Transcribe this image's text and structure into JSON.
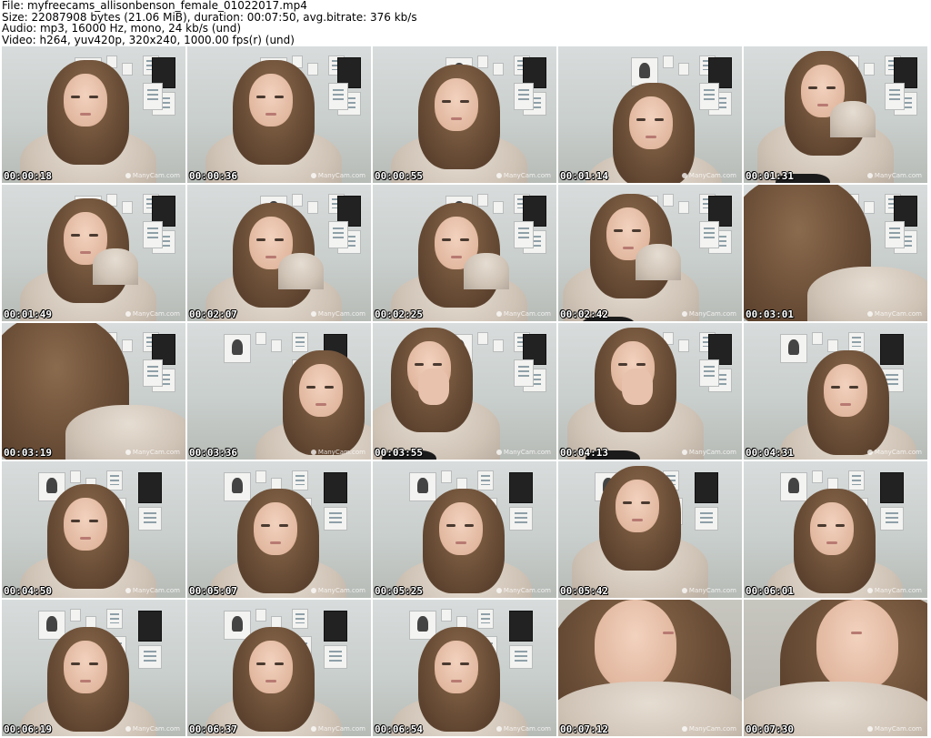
{
  "header": {
    "line1": "File: myfreecams_allisonbenson_female_01022017.mp4",
    "line2": "Size: 22087908 bytes (21.06 MiB), duration: 00:07:50, avg.bitrate: 376 kb/s",
    "line3": "Audio: mp3, 16000 Hz, mono, 24 kb/s (und)",
    "line4": "Video: h264, yuv420p, 320x240, 1000.00 fps(r) (und)"
  },
  "watermark": "ManyCam.com",
  "thumbnails": [
    {
      "time": "00:00:18"
    },
    {
      "time": "00:00:36"
    },
    {
      "time": "00:00:55"
    },
    {
      "time": "00:01:14"
    },
    {
      "time": "00:01:31"
    },
    {
      "time": "00:01:49"
    },
    {
      "time": "00:02:07"
    },
    {
      "time": "00:02:25"
    },
    {
      "time": "00:02:42"
    },
    {
      "time": "00:03:01"
    },
    {
      "time": "00:03:19"
    },
    {
      "time": "00:03:36"
    },
    {
      "time": "00:03:55"
    },
    {
      "time": "00:04:13"
    },
    {
      "time": "00:04:31"
    },
    {
      "time": "00:04:50"
    },
    {
      "time": "00:05:07"
    },
    {
      "time": "00:05:25"
    },
    {
      "time": "00:05:42"
    },
    {
      "time": "00:06:01"
    },
    {
      "time": "00:06:19"
    },
    {
      "time": "00:06:37"
    },
    {
      "time": "00:06:54"
    },
    {
      "time": "00:07:12"
    },
    {
      "time": "00:07:30"
    }
  ]
}
